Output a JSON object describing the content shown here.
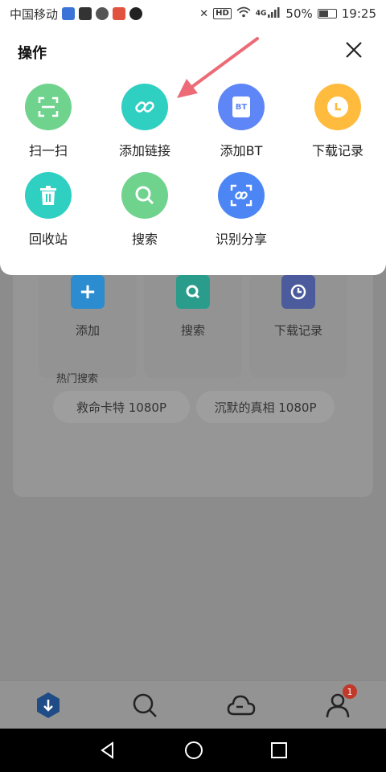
{
  "status_bar": {
    "carrier": "中国移动",
    "network": "HD",
    "signal_label": "4G",
    "battery": "50%",
    "time": "19:25"
  },
  "sheet": {
    "title": "操作",
    "actions": [
      {
        "label": "扫一扫",
        "icon": "scan-icon",
        "color": "#6fd38e"
      },
      {
        "label": "添加链接",
        "icon": "link-icon",
        "color": "#2fcfc2"
      },
      {
        "label": "添加BT",
        "icon": "bt-icon",
        "color": "#5e86f6",
        "icon_text": "BT"
      },
      {
        "label": "下载记录",
        "icon": "clock-icon",
        "color": "#ffbb3d"
      },
      {
        "label": "回收站",
        "icon": "trash-icon",
        "color": "#2fcfc2"
      },
      {
        "label": "搜索",
        "icon": "search-icon",
        "color": "#6fd38e"
      },
      {
        "label": "识别分享",
        "icon": "share-recognize-icon",
        "color": "#4c86f5"
      }
    ]
  },
  "background": {
    "tiles": [
      {
        "label": "添加",
        "color": "#2b8ccf"
      },
      {
        "label": "搜索",
        "color": "#2a9c8c"
      },
      {
        "label": "下载记录",
        "color": "#4b5b9c"
      }
    ],
    "hot_title": "热门搜索",
    "hot_chips": [
      "救命卡特 1080P",
      "沉默的真相 1080P"
    ]
  },
  "tab_bar": {
    "badge_count": "1"
  }
}
